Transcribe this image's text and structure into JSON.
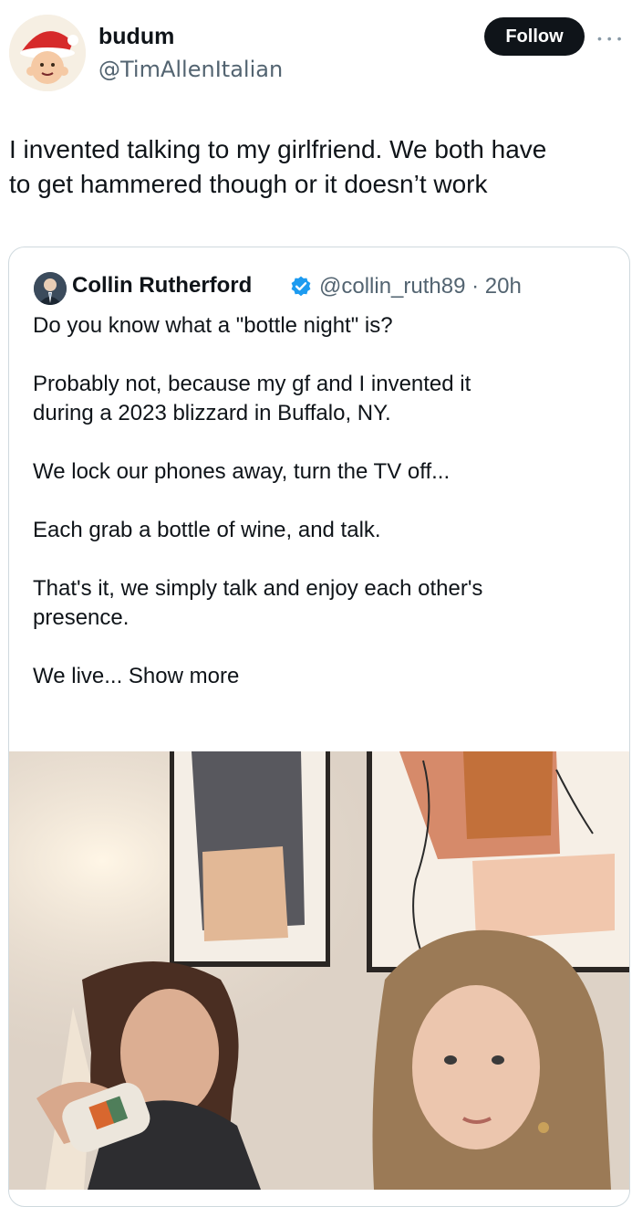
{
  "author": {
    "display_name": "budum",
    "handle": "@TimAllenItalian"
  },
  "follow_label": "Follow",
  "more_icon": "more-dots-icon",
  "post_text": "I invented talking to my girlfriend. We both have\nto get hammered though or it doesn’t work",
  "quoted": {
    "display_name": "Collin Rutherford",
    "verified_icon": "verified-badge-icon",
    "meta": "@collin_ruth89 · 20h",
    "text": "Do you know what a \"bottle night\" is?\n\nProbably not, because my gf and I invented it\nduring a 2023 blizzard in Buffalo, NY.\n\nWe lock our phones away, turn the TV off...\n\nEach grab a bottle of wine, and talk.\n\nThat's it, we simply talk and enjoy each other's\npresence.\n\nWe live...",
    "show_more": " Show more",
    "photo_icon": "couple-photo"
  },
  "colors": {
    "text": "#0f1419",
    "secondary": "#536471",
    "verified": "#1d9bf0",
    "border": "#cfd9de",
    "follow_bg": "#0f1419"
  }
}
